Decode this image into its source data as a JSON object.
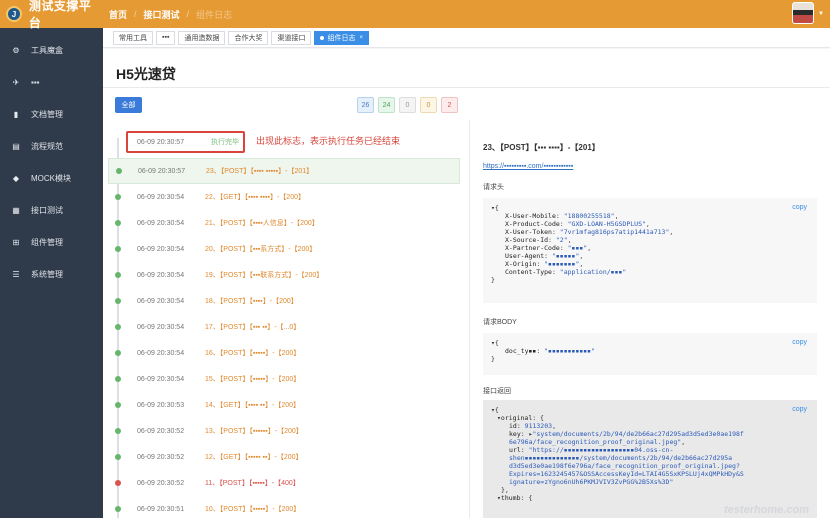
{
  "app": {
    "title": "测试支撑平台",
    "logo_letter": "J"
  },
  "sidebar": {
    "items": [
      {
        "icon": "gear-icon",
        "glyph": "⚙",
        "label": "工具魔盒"
      },
      {
        "icon": "paper-plane-icon",
        "glyph": "✈",
        "label": "▪▪▪"
      },
      {
        "icon": "file-icon",
        "glyph": "▮",
        "label": "文档管理"
      },
      {
        "icon": "chart-icon",
        "glyph": "▤",
        "label": "流程规范"
      },
      {
        "icon": "cube-icon",
        "glyph": "◆",
        "label": "MOCK模块"
      },
      {
        "icon": "grid-icon",
        "glyph": "▦",
        "label": "接口测试"
      },
      {
        "icon": "sitemap-icon",
        "glyph": "⊞",
        "label": "组件管理"
      },
      {
        "icon": "list-icon",
        "glyph": "☰",
        "label": "系统管理"
      }
    ]
  },
  "header": {
    "breadcrumb": [
      "首页",
      "接口测试",
      "组件日志"
    ],
    "separator": "/"
  },
  "tabs": [
    {
      "label": "常用工具",
      "active": false
    },
    {
      "label": "▪▪▪",
      "active": false
    },
    {
      "label": "通用造数据",
      "active": false
    },
    {
      "label": "合作大奖",
      "active": false
    },
    {
      "label": "渠道接口",
      "active": false
    },
    {
      "label": "组件日志",
      "active": true,
      "close": "×"
    }
  ],
  "page": {
    "title": "H5光速贷",
    "all_button": "全部",
    "counts": [
      "26",
      "24",
      "0",
      "0",
      "2"
    ]
  },
  "timeline": {
    "annotation": "出现此标志，表示执行任务已经结束",
    "rows": [
      {
        "time": "06-09 20:30:57",
        "label": "执行完毕",
        "status": "done"
      },
      {
        "time": "06-09 20:30:57",
        "label": "23、【POST】【▪▪▪▪ ▪▪▪▪▪】-【201】",
        "status": "ok",
        "hl": true
      },
      {
        "time": "06-09 20:30:54",
        "label": "22、【GET】【▪▪▪▪ ▪▪▪▪】-【200】",
        "status": "ok"
      },
      {
        "time": "06-09 20:30:54",
        "label": "21、【POST】【▪▪▪▪人信息】-【200】",
        "status": "ok"
      },
      {
        "time": "06-09 20:30:54",
        "label": "20、【POST】【▪▪▪系方式】-【200】",
        "status": "ok"
      },
      {
        "time": "06-09 20:30:54",
        "label": "19、【POST】【▪▪▪联系方式】-【200】",
        "status": "ok"
      },
      {
        "time": "06-09 20:30:54",
        "label": "18、【POST】【▪▪▪▪】-【200】",
        "status": "ok"
      },
      {
        "time": "06-09 20:30:54",
        "label": "17、【POST】【▪▪▪ ▪▪】-【...0】",
        "status": "ok"
      },
      {
        "time": "06-09 20:30:54",
        "label": "16、【POST】【▪▪▪▪▪】-【200】",
        "status": "ok"
      },
      {
        "time": "06-09 20:30:54",
        "label": "15、【POST】【▪▪▪▪▪】-【200】",
        "status": "ok"
      },
      {
        "time": "06-09 20:30:53",
        "label": "14、【GET】【▪▪▪▪ ▪▪】-【200】",
        "status": "ok"
      },
      {
        "time": "06-09 20:30:52",
        "label": "13、【POST】【▪▪▪▪▪▪】-【200】",
        "status": "ok"
      },
      {
        "time": "06-09 20:30:52",
        "label": "12、【GET】【▪▪▪▪▪ ▪▪】-【200】",
        "status": "ok"
      },
      {
        "time": "06-09 20:30:52",
        "label": "11、【POST】【▪▪▪▪▪】-【400】",
        "status": "err"
      },
      {
        "time": "06-09 20:30:51",
        "label": "10、【POST】【▪▪▪▪▪】-【200】",
        "status": "ok"
      }
    ]
  },
  "detail": {
    "title": "23、【POST】【▪▪▪ ▪▪▪▪】-【201】",
    "url": "https://▪▪▪▪▪▪▪▪▪.com/▪▪▪▪▪▪▪▪▪▪▪▪",
    "headers_label": "请求头",
    "body_label": "请求BODY",
    "response_label": "接口返回",
    "copy": "copy",
    "headers": [
      {
        "k": "X-User-Mobile",
        "v": "\"18800255518\""
      },
      {
        "k": "X-Product-Code",
        "v": "\"GXD-LOAN-H5GSDPLUS\""
      },
      {
        "k": "X-User-Token",
        "v": "\"7vr1mfag816ps7atip1441a713\""
      },
      {
        "k": "X-Source-Id",
        "v": "\"2\""
      },
      {
        "k": "X-Partner-Code",
        "v": "\"▪▪▪\""
      },
      {
        "k": "User-Agent",
        "v": "\"▪▪▪▪▪\""
      },
      {
        "k": "X-Origin",
        "v": "\"▪▪▪▪▪▪▪\""
      },
      {
        "k": "Content-Type",
        "v": "\"application/▪▪▪\""
      }
    ],
    "body": [
      {
        "k": "doc_ty▪▪",
        "v": "\"▪▪▪▪▪▪▪▪▪▪▪\""
      }
    ],
    "response": {
      "original_key": "original",
      "id_key": "id",
      "id": "9113203",
      "key_key": "key",
      "key_lines": [
        "\"system/documents/2b/94/de2b66ac27d295ad3d5ed3e0ae198f",
        "6e796a/face_recognition_proof_original.jpeg\""
      ],
      "url_key": "url",
      "url_lines": [
        "\"https://▪▪▪▪▪▪▪▪▪▪▪▪▪▪▪▪▪▪04.oss-cn-",
        "shen▪▪▪▪▪▪▪▪▪▪▪▪▪▪/system/documents/2b/94/de2b66ac27d295a",
        "d3d5ed3e0ae198f6e796a/face_recognition_proof_original.jpeg?",
        "Expires=1623245457&OSSAccessKeyId=LTAI4G5SxKPSLUj4xQMPkHDy&S",
        "ignature=zYgno6nUh6PKMJVIV3ZvPGG%2B5Xs%3D\""
      ],
      "thumb_key": "thumb"
    },
    "watermark": "testerhome.com"
  }
}
